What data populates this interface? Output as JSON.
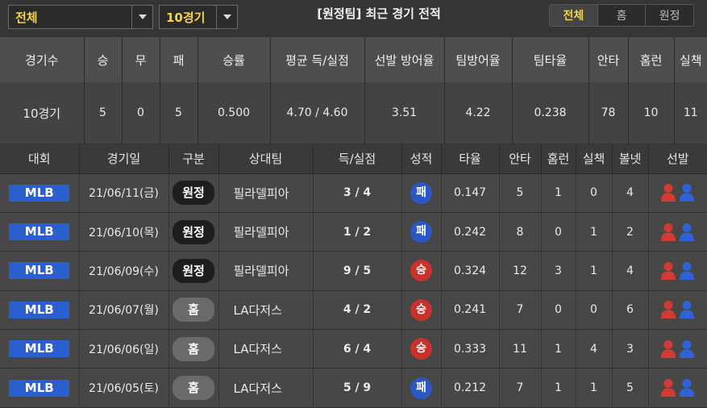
{
  "filters": {
    "scope_value": "전체",
    "games_value": "10경기"
  },
  "title": "[원정팀] 최근 경기 전적",
  "toggle": {
    "all": "전체",
    "home": "홈",
    "away": "원정"
  },
  "summary": {
    "headers": [
      "경기수",
      "승",
      "무",
      "패",
      "승률",
      "평균 득/실점",
      "선발 방어율",
      "팀방어율",
      "팀타율",
      "안타",
      "홈런",
      "실책"
    ],
    "values": [
      "10경기",
      "5",
      "0",
      "5",
      "0.500",
      "4.70 / 4.60",
      "3.51",
      "4.22",
      "0.238",
      "78",
      "10",
      "11"
    ]
  },
  "games": {
    "headers": [
      "대회",
      "경기일",
      "구분",
      "상대팀",
      "득/실점",
      "성적",
      "타율",
      "안타",
      "홈런",
      "실책",
      "볼넷",
      "선발"
    ],
    "rows": [
      {
        "league": "MLB",
        "date": "21/06/11(금)",
        "type": "원정",
        "opponent": "필라델피아",
        "score": "3 / 4",
        "result": "패",
        "avg": "0.147",
        "hits": "5",
        "hr": "1",
        "err": "0",
        "bb": "4"
      },
      {
        "league": "MLB",
        "date": "21/06/10(목)",
        "type": "원정",
        "opponent": "필라델피아",
        "score": "1 / 2",
        "result": "패",
        "avg": "0.242",
        "hits": "8",
        "hr": "0",
        "err": "1",
        "bb": "2"
      },
      {
        "league": "MLB",
        "date": "21/06/09(수)",
        "type": "원정",
        "opponent": "필라델피아",
        "score": "9 / 5",
        "result": "승",
        "avg": "0.324",
        "hits": "12",
        "hr": "3",
        "err": "1",
        "bb": "4"
      },
      {
        "league": "MLB",
        "date": "21/06/07(월)",
        "type": "홈",
        "opponent": "LA다저스",
        "score": "4 / 2",
        "result": "승",
        "avg": "0.241",
        "hits": "7",
        "hr": "0",
        "err": "0",
        "bb": "6"
      },
      {
        "league": "MLB",
        "date": "21/06/06(일)",
        "type": "홈",
        "opponent": "LA다저스",
        "score": "6 / 4",
        "result": "승",
        "avg": "0.333",
        "hits": "11",
        "hr": "1",
        "err": "4",
        "bb": "3"
      },
      {
        "league": "MLB",
        "date": "21/06/05(토)",
        "type": "홈",
        "opponent": "LA다저스",
        "score": "5 / 9",
        "result": "패",
        "avg": "0.212",
        "hits": "7",
        "hr": "1",
        "err": "1",
        "bb": "5"
      }
    ]
  },
  "colors": {
    "accent_yellow": "#f1d44a",
    "league_blue": "#2b5fcf",
    "win_red": "#c8312c",
    "loss_blue": "#2c56c4",
    "pitcher_red": "#d23a33",
    "pitcher_blue": "#2f62d6"
  },
  "icons": {
    "pitcher_left": "red-person-icon",
    "pitcher_right": "blue-person-icon"
  }
}
